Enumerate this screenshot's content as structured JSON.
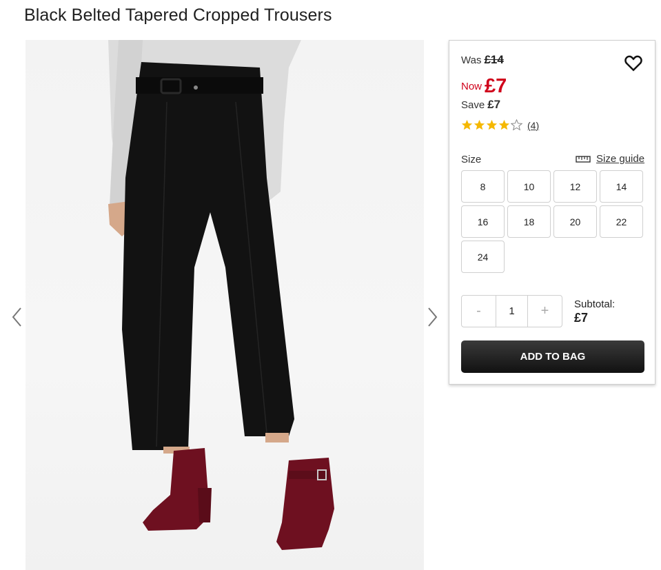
{
  "product": {
    "title": "Black Belted Tapered Cropped Trousers"
  },
  "pricing": {
    "was_label": "Was",
    "was_price": "£14",
    "now_label": "Now",
    "now_price": "£7",
    "save_label": "Save",
    "save_amount": "£7"
  },
  "rating": {
    "stars_filled": 4,
    "stars_total": 5,
    "review_count": "(4)"
  },
  "size": {
    "label": "Size",
    "guide_label": "Size guide",
    "options": [
      "8",
      "10",
      "12",
      "14",
      "16",
      "18",
      "20",
      "22",
      "24"
    ]
  },
  "quantity": {
    "minus": "-",
    "value": "1",
    "plus": "+"
  },
  "subtotal": {
    "label": "Subtotal:",
    "value": "£7"
  },
  "actions": {
    "add_to_bag": "ADD TO BAG"
  },
  "colors": {
    "sale_red": "#d0021b",
    "star_gold": "#f5b800",
    "button_dark": "#1a1a1a"
  }
}
